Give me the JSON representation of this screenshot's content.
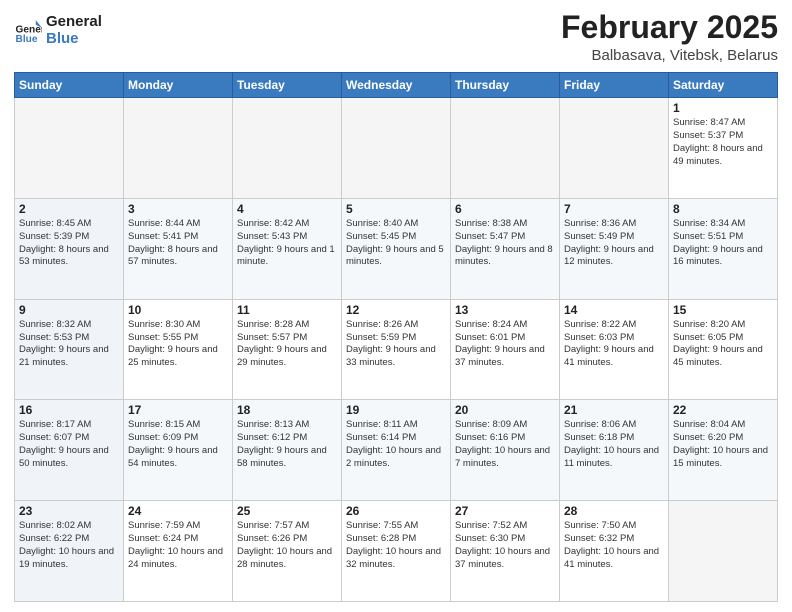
{
  "header": {
    "logo_general": "General",
    "logo_blue": "Blue",
    "month_title": "February 2025",
    "location": "Balbasava, Vitebsk, Belarus"
  },
  "weekdays": [
    "Sunday",
    "Monday",
    "Tuesday",
    "Wednesday",
    "Thursday",
    "Friday",
    "Saturday"
  ],
  "weeks": [
    [
      {
        "day": "",
        "info": ""
      },
      {
        "day": "",
        "info": ""
      },
      {
        "day": "",
        "info": ""
      },
      {
        "day": "",
        "info": ""
      },
      {
        "day": "",
        "info": ""
      },
      {
        "day": "",
        "info": ""
      },
      {
        "day": "1",
        "info": "Sunrise: 8:47 AM\nSunset: 5:37 PM\nDaylight: 8 hours and 49 minutes."
      }
    ],
    [
      {
        "day": "2",
        "info": "Sunrise: 8:45 AM\nSunset: 5:39 PM\nDaylight: 8 hours and 53 minutes."
      },
      {
        "day": "3",
        "info": "Sunrise: 8:44 AM\nSunset: 5:41 PM\nDaylight: 8 hours and 57 minutes."
      },
      {
        "day": "4",
        "info": "Sunrise: 8:42 AM\nSunset: 5:43 PM\nDaylight: 9 hours and 1 minute."
      },
      {
        "day": "5",
        "info": "Sunrise: 8:40 AM\nSunset: 5:45 PM\nDaylight: 9 hours and 5 minutes."
      },
      {
        "day": "6",
        "info": "Sunrise: 8:38 AM\nSunset: 5:47 PM\nDaylight: 9 hours and 8 minutes."
      },
      {
        "day": "7",
        "info": "Sunrise: 8:36 AM\nSunset: 5:49 PM\nDaylight: 9 hours and 12 minutes."
      },
      {
        "day": "8",
        "info": "Sunrise: 8:34 AM\nSunset: 5:51 PM\nDaylight: 9 hours and 16 minutes."
      }
    ],
    [
      {
        "day": "9",
        "info": "Sunrise: 8:32 AM\nSunset: 5:53 PM\nDaylight: 9 hours and 21 minutes."
      },
      {
        "day": "10",
        "info": "Sunrise: 8:30 AM\nSunset: 5:55 PM\nDaylight: 9 hours and 25 minutes."
      },
      {
        "day": "11",
        "info": "Sunrise: 8:28 AM\nSunset: 5:57 PM\nDaylight: 9 hours and 29 minutes."
      },
      {
        "day": "12",
        "info": "Sunrise: 8:26 AM\nSunset: 5:59 PM\nDaylight: 9 hours and 33 minutes."
      },
      {
        "day": "13",
        "info": "Sunrise: 8:24 AM\nSunset: 6:01 PM\nDaylight: 9 hours and 37 minutes."
      },
      {
        "day": "14",
        "info": "Sunrise: 8:22 AM\nSunset: 6:03 PM\nDaylight: 9 hours and 41 minutes."
      },
      {
        "day": "15",
        "info": "Sunrise: 8:20 AM\nSunset: 6:05 PM\nDaylight: 9 hours and 45 minutes."
      }
    ],
    [
      {
        "day": "16",
        "info": "Sunrise: 8:17 AM\nSunset: 6:07 PM\nDaylight: 9 hours and 50 minutes."
      },
      {
        "day": "17",
        "info": "Sunrise: 8:15 AM\nSunset: 6:09 PM\nDaylight: 9 hours and 54 minutes."
      },
      {
        "day": "18",
        "info": "Sunrise: 8:13 AM\nSunset: 6:12 PM\nDaylight: 9 hours and 58 minutes."
      },
      {
        "day": "19",
        "info": "Sunrise: 8:11 AM\nSunset: 6:14 PM\nDaylight: 10 hours and 2 minutes."
      },
      {
        "day": "20",
        "info": "Sunrise: 8:09 AM\nSunset: 6:16 PM\nDaylight: 10 hours and 7 minutes."
      },
      {
        "day": "21",
        "info": "Sunrise: 8:06 AM\nSunset: 6:18 PM\nDaylight: 10 hours and 11 minutes."
      },
      {
        "day": "22",
        "info": "Sunrise: 8:04 AM\nSunset: 6:20 PM\nDaylight: 10 hours and 15 minutes."
      }
    ],
    [
      {
        "day": "23",
        "info": "Sunrise: 8:02 AM\nSunset: 6:22 PM\nDaylight: 10 hours and 19 minutes."
      },
      {
        "day": "24",
        "info": "Sunrise: 7:59 AM\nSunset: 6:24 PM\nDaylight: 10 hours and 24 minutes."
      },
      {
        "day": "25",
        "info": "Sunrise: 7:57 AM\nSunset: 6:26 PM\nDaylight: 10 hours and 28 minutes."
      },
      {
        "day": "26",
        "info": "Sunrise: 7:55 AM\nSunset: 6:28 PM\nDaylight: 10 hours and 32 minutes."
      },
      {
        "day": "27",
        "info": "Sunrise: 7:52 AM\nSunset: 6:30 PM\nDaylight: 10 hours and 37 minutes."
      },
      {
        "day": "28",
        "info": "Sunrise: 7:50 AM\nSunset: 6:32 PM\nDaylight: 10 hours and 41 minutes."
      },
      {
        "day": "",
        "info": ""
      }
    ]
  ]
}
